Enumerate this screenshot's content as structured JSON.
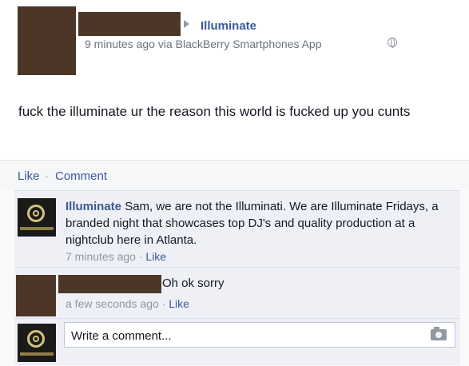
{
  "post": {
    "page_name": "Illuminate",
    "timestamp": "9 minutes ago",
    "via": "via BlackBerry Smartphones App",
    "text": "fuck the illuminate ur the reason this world is fucked up you cunts"
  },
  "actions": {
    "like": "Like",
    "separator": "·",
    "comment": "Comment"
  },
  "comments": [
    {
      "author": "Illuminate",
      "text": "Sam, we are not the Illuminati. We are Illuminate Fridays, a branded night that showcases top DJ's and quality production at a nightclub here in Atlanta.",
      "time": "7 minutes ago",
      "like": "Like"
    },
    {
      "text": "Oh ok sorry",
      "time": "a few seconds ago",
      "like": "Like"
    }
  ],
  "write": {
    "placeholder": "Write a comment..."
  },
  "icons": {
    "globe": "globe-icon",
    "arrow": "arrow-right-icon",
    "camera": "camera-icon"
  }
}
